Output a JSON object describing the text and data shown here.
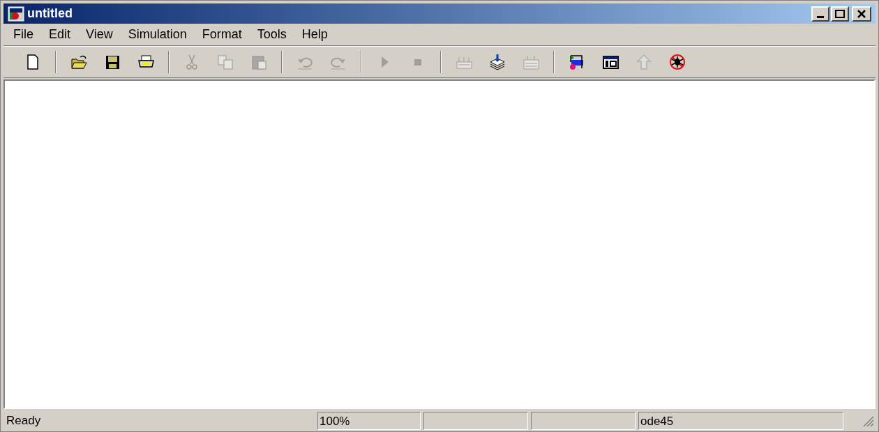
{
  "window": {
    "title": "untitled"
  },
  "menu": [
    "File",
    "Edit",
    "View",
    "Simulation",
    "Format",
    "Tools",
    "Help"
  ],
  "toolbar": [
    {
      "kind": "button",
      "disabled": false
    },
    {
      "kind": "separator"
    },
    {
      "kind": "button",
      "disabled": false
    },
    {
      "kind": "button",
      "disabled": false
    },
    {
      "kind": "button",
      "disabled": false
    },
    {
      "kind": "separator"
    },
    {
      "kind": "button",
      "disabled": true
    },
    {
      "kind": "button",
      "disabled": true
    },
    {
      "kind": "button",
      "disabled": true
    },
    {
      "kind": "separator"
    },
    {
      "kind": "button",
      "disabled": true
    },
    {
      "kind": "button",
      "disabled": true
    },
    {
      "kind": "separator"
    },
    {
      "kind": "button",
      "disabled": true
    },
    {
      "kind": "button",
      "disabled": true
    },
    {
      "kind": "separator"
    },
    {
      "kind": "button",
      "disabled": true
    },
    {
      "kind": "button",
      "disabled": false
    },
    {
      "kind": "button",
      "disabled": true
    },
    {
      "kind": "separator"
    },
    {
      "kind": "button",
      "disabled": false
    },
    {
      "kind": "button",
      "disabled": false
    },
    {
      "kind": "button",
      "disabled": true
    },
    {
      "kind": "button",
      "disabled": false
    }
  ],
  "status_bar": {
    "message": "Ready",
    "zoom": "100%",
    "solver": "ode45"
  }
}
